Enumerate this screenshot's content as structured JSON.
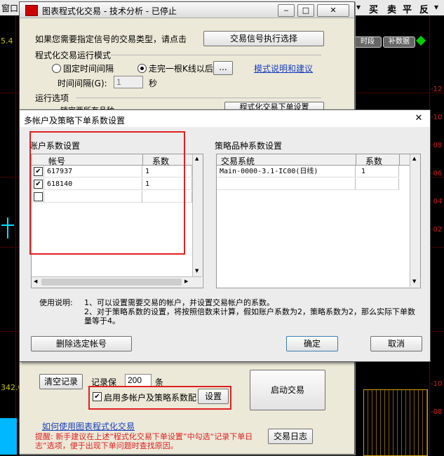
{
  "background": {
    "menu_fragment": "窗口(",
    "toolbar_right": [
      "买",
      "卖",
      "平",
      "反"
    ],
    "tags": [
      "时段",
      "补数据"
    ],
    "values_left": [
      "5.4",
      "342.0"
    ],
    "values_right": [
      "-12",
      "-10",
      "-08",
      "-06",
      "-04",
      "-02",
      "-10",
      "-08"
    ],
    "accent_green": "#00cc00"
  },
  "main": {
    "title": "图表程式化交易 - 技术分析 - 已停止",
    "signal_prompt": "如果您需要指定信号的交易类型，请点击",
    "signal_button": "交易信号执行选择",
    "mode_group": "程式化交易运行模式",
    "radio_fixed": "固定时间间隔",
    "radio_after_k": "走完一根K线以后",
    "dots_button": "...",
    "mode_link": "模式说明和建议",
    "interval_label": "时间间隔(G):",
    "interval_value": "1",
    "interval_unit": "秒",
    "options_group": "运行选项",
    "option_partial": "锁定两所有品种",
    "option_partial_button": "程式化交易下单设置",
    "clear_log": "清空记录",
    "keep_label": "记录保",
    "keep_value": "200",
    "keep_unit": "条",
    "multi_account_check": "启用多帐户及策略系数配",
    "settings_button": "设置",
    "start_button": "启动交易",
    "howto_link": "如何使用图表程式化交易",
    "log_button": "交易日志",
    "reminder": "提醒: 新手建议在上述“程式化交易下单设置”中勾选“记录下单日志”选项，便于出现下单问题时查找原因。"
  },
  "dialog": {
    "title": "多帐户及策略下单系数设置",
    "account_section": "账户系数设置",
    "account_headers": [
      "帐号",
      "系数"
    ],
    "accounts": [
      {
        "checked": true,
        "id": "617937",
        "coef": "1"
      },
      {
        "checked": true,
        "id": "618140",
        "coef": "1"
      },
      {
        "checked": false,
        "id": "",
        "coef": ""
      }
    ],
    "strategy_section": "策略品种系数设置",
    "strategy_headers": [
      "交易系统",
      "系数"
    ],
    "strategies": [
      {
        "name": "Main-0000-3.1-IC00(日线)",
        "coef": "1"
      }
    ],
    "usage_title": "使用说明:",
    "usage_1": "1、可以设置需要交易的帐户，并设置交易帐户的系数。",
    "usage_2": "2、对于策略系数的设置，将按照倍数来计算，假如账户系数为2，策略系数为2，那么实际下单数量等于4。",
    "delete_button": "删除选定帐号",
    "ok_button": "确定",
    "cancel_button": "取消",
    "close_glyph": "✕"
  }
}
